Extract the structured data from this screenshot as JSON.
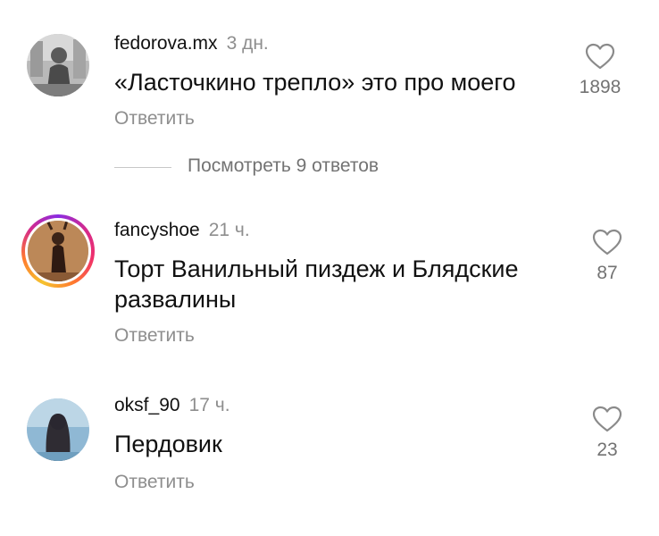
{
  "comments": [
    {
      "username": "fedorova.mx",
      "time": "3 дн.",
      "text": "«Ласточкино трепло» это про моего",
      "reply_label": "Ответить",
      "likes": "1898",
      "has_story_ring": false
    },
    {
      "username": "fancyshoe",
      "time": "21 ч.",
      "text": "Торт Ванильный пиздеж и Блядские развалины",
      "reply_label": "Ответить",
      "likes": "87",
      "has_story_ring": true
    },
    {
      "username": "oksf_90",
      "time": "17 ч.",
      "text": "Пердовик",
      "reply_label": "Ответить",
      "likes": "23",
      "has_story_ring": false
    }
  ],
  "view_replies": {
    "label": "Посмотреть 9 ответов"
  },
  "icons": {
    "like": "heart-outline-icon"
  },
  "colors": {
    "secondary_text": "#8e8e8e",
    "story_ring_start": "#d42a8c",
    "story_ring_end": "#f5c32f"
  }
}
